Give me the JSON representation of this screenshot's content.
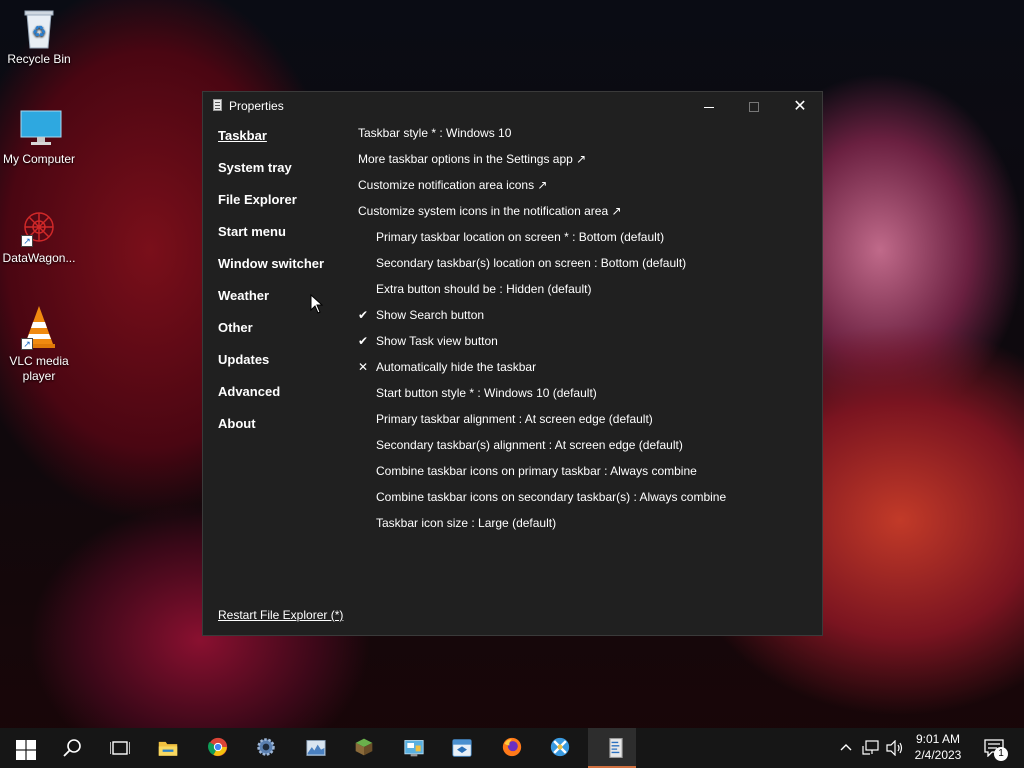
{
  "desktop": {
    "icons": [
      {
        "label": "Recycle Bin",
        "icon": "recycle-bin-icon"
      },
      {
        "label": "My Computer",
        "icon": "monitor-icon"
      },
      {
        "label": "DataWagon...",
        "icon": "datawagon-icon"
      },
      {
        "label": "VLC media player",
        "icon": "vlc-icon"
      }
    ]
  },
  "window": {
    "title": "Properties",
    "nav": [
      "Taskbar",
      "System tray",
      "File Explorer",
      "Start menu",
      "Window switcher",
      "Weather",
      "Other",
      "Updates",
      "Advanced",
      "About"
    ],
    "restart_link": "Restart File Explorer (*)",
    "settings": [
      {
        "text": "Taskbar style * : Windows 10",
        "mark": ""
      },
      {
        "text": "More taskbar options in the Settings app ↗",
        "mark": ""
      },
      {
        "text": "Customize notification area icons ↗",
        "mark": ""
      },
      {
        "text": "Customize system icons in the notification area ↗",
        "mark": ""
      },
      {
        "text": "Primary taskbar location on screen * : Bottom (default)",
        "mark": ""
      },
      {
        "text": "Secondary taskbar(s) location on screen : Bottom (default)",
        "mark": ""
      },
      {
        "text": "Extra button should be : Hidden (default)",
        "mark": ""
      },
      {
        "text": "Show Search button",
        "mark": "✔"
      },
      {
        "text": "Show Task view button",
        "mark": "✔"
      },
      {
        "text": "Automatically hide the taskbar",
        "mark": "✕"
      },
      {
        "text": "Start button style * : Windows 10 (default)",
        "mark": ""
      },
      {
        "text": "Primary taskbar alignment : At screen edge (default)",
        "mark": ""
      },
      {
        "text": "Secondary taskbar(s) alignment : At screen edge (default)",
        "mark": ""
      },
      {
        "text": "Combine taskbar icons on primary taskbar : Always combine",
        "mark": ""
      },
      {
        "text": "Combine taskbar icons on secondary taskbar(s) : Always combine",
        "mark": ""
      },
      {
        "text": "Taskbar icon size : Large (default)",
        "mark": ""
      }
    ]
  },
  "taskbar": {
    "apps": [
      "start-icon",
      "search-icon",
      "task-view-icon",
      "file-explorer-icon",
      "chrome-icon",
      "settings-gear-icon",
      "monitor-app-icon",
      "minecraft-icon",
      "control-panel-icon",
      "app-window-icon",
      "firefox-icon",
      "tool-app-icon",
      "properties-app-icon"
    ],
    "clock_time": "9:01 AM",
    "clock_date": "2/4/2023",
    "notification_count": "1"
  }
}
